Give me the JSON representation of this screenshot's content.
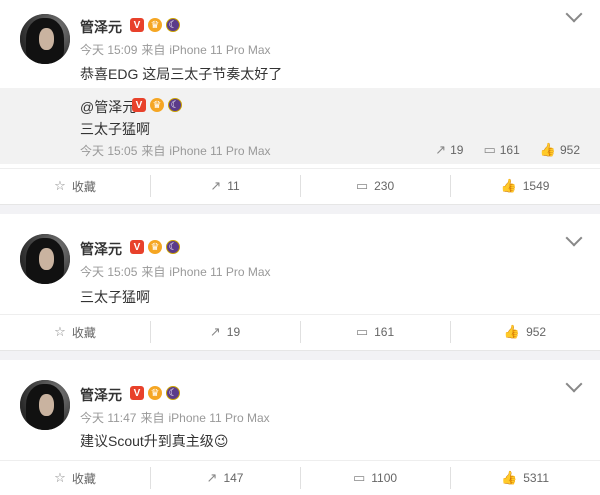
{
  "posts": [
    {
      "user": "管泽元",
      "time": "今天 15:09",
      "source_prefix": "来自",
      "device": "iPhone 11 Pro Max",
      "text": "恭喜EDG 这局三太子节奏太好了",
      "repost": {
        "user": "@管泽元",
        "text": "三太子猛啊",
        "time": "今天 15:05",
        "source_prefix": "来自",
        "device": "iPhone 11 Pro Max",
        "reposts": "19",
        "comments": "161",
        "likes": "952"
      },
      "actions": {
        "favorite": "收藏",
        "reposts": "11",
        "comments": "230",
        "likes": "1549"
      }
    },
    {
      "user": "管泽元",
      "time": "今天 15:05",
      "source_prefix": "来自",
      "device": "iPhone 11 Pro Max",
      "text": "三太子猛啊",
      "actions": {
        "favorite": "收藏",
        "reposts": "19",
        "comments": "161",
        "likes": "952"
      }
    },
    {
      "user": "管泽元",
      "time": "今天 11:47",
      "source_prefix": "来自",
      "device": "iPhone 11 Pro Max",
      "text": "建议Scout升到真主级",
      "emoji": "😉",
      "actions": {
        "favorite": "收藏",
        "reposts": "147",
        "comments": "1100",
        "likes": "5311"
      }
    }
  ],
  "icons": {
    "favorite": "star-icon",
    "repost": "share-icon",
    "comment": "comment-icon",
    "like": "thumbs-up-icon",
    "more": "chevron-down-icon"
  },
  "colors": {
    "verified": "#e8412b",
    "crown": "#f5a623",
    "night": "#5b3b8a"
  }
}
